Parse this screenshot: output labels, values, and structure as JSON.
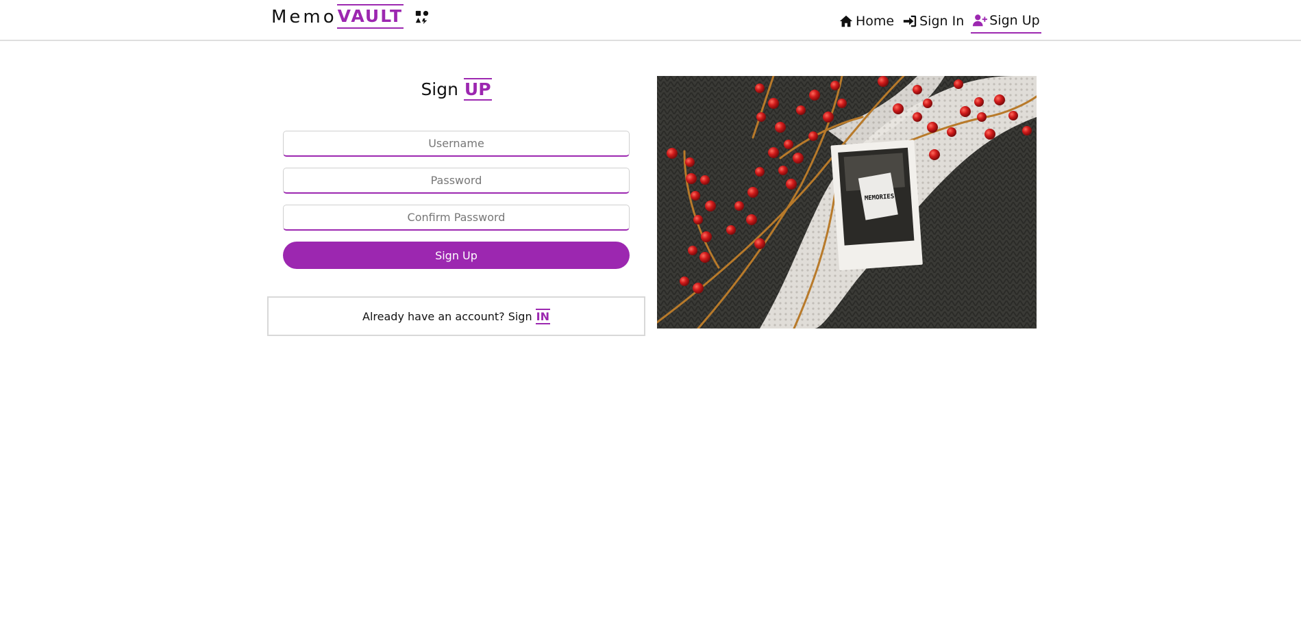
{
  "brand": {
    "part1": "Memo",
    "part2": "VAULT",
    "icon": "shapes-icon"
  },
  "nav": {
    "home": {
      "label": "Home",
      "icon": "home-icon"
    },
    "signin": {
      "label": "Sign In",
      "icon": "sign-in-icon"
    },
    "signup": {
      "label": "Sign Up",
      "icon": "user-plus-icon",
      "active": true
    }
  },
  "form": {
    "title_main": "Sign",
    "title_accent": "UP",
    "username_placeholder": "Username",
    "username_value": "",
    "password_placeholder": "Password",
    "password_value": "",
    "confirm_placeholder": "Confirm Password",
    "confirm_value": "",
    "submit_label": "Sign Up"
  },
  "signin_prompt": {
    "text": "Already have an account? Sign",
    "link": "IN"
  },
  "hero": {
    "photo_text": "MEMORIES"
  },
  "colors": {
    "accent": "#9c27b0",
    "border": "#dedede"
  }
}
